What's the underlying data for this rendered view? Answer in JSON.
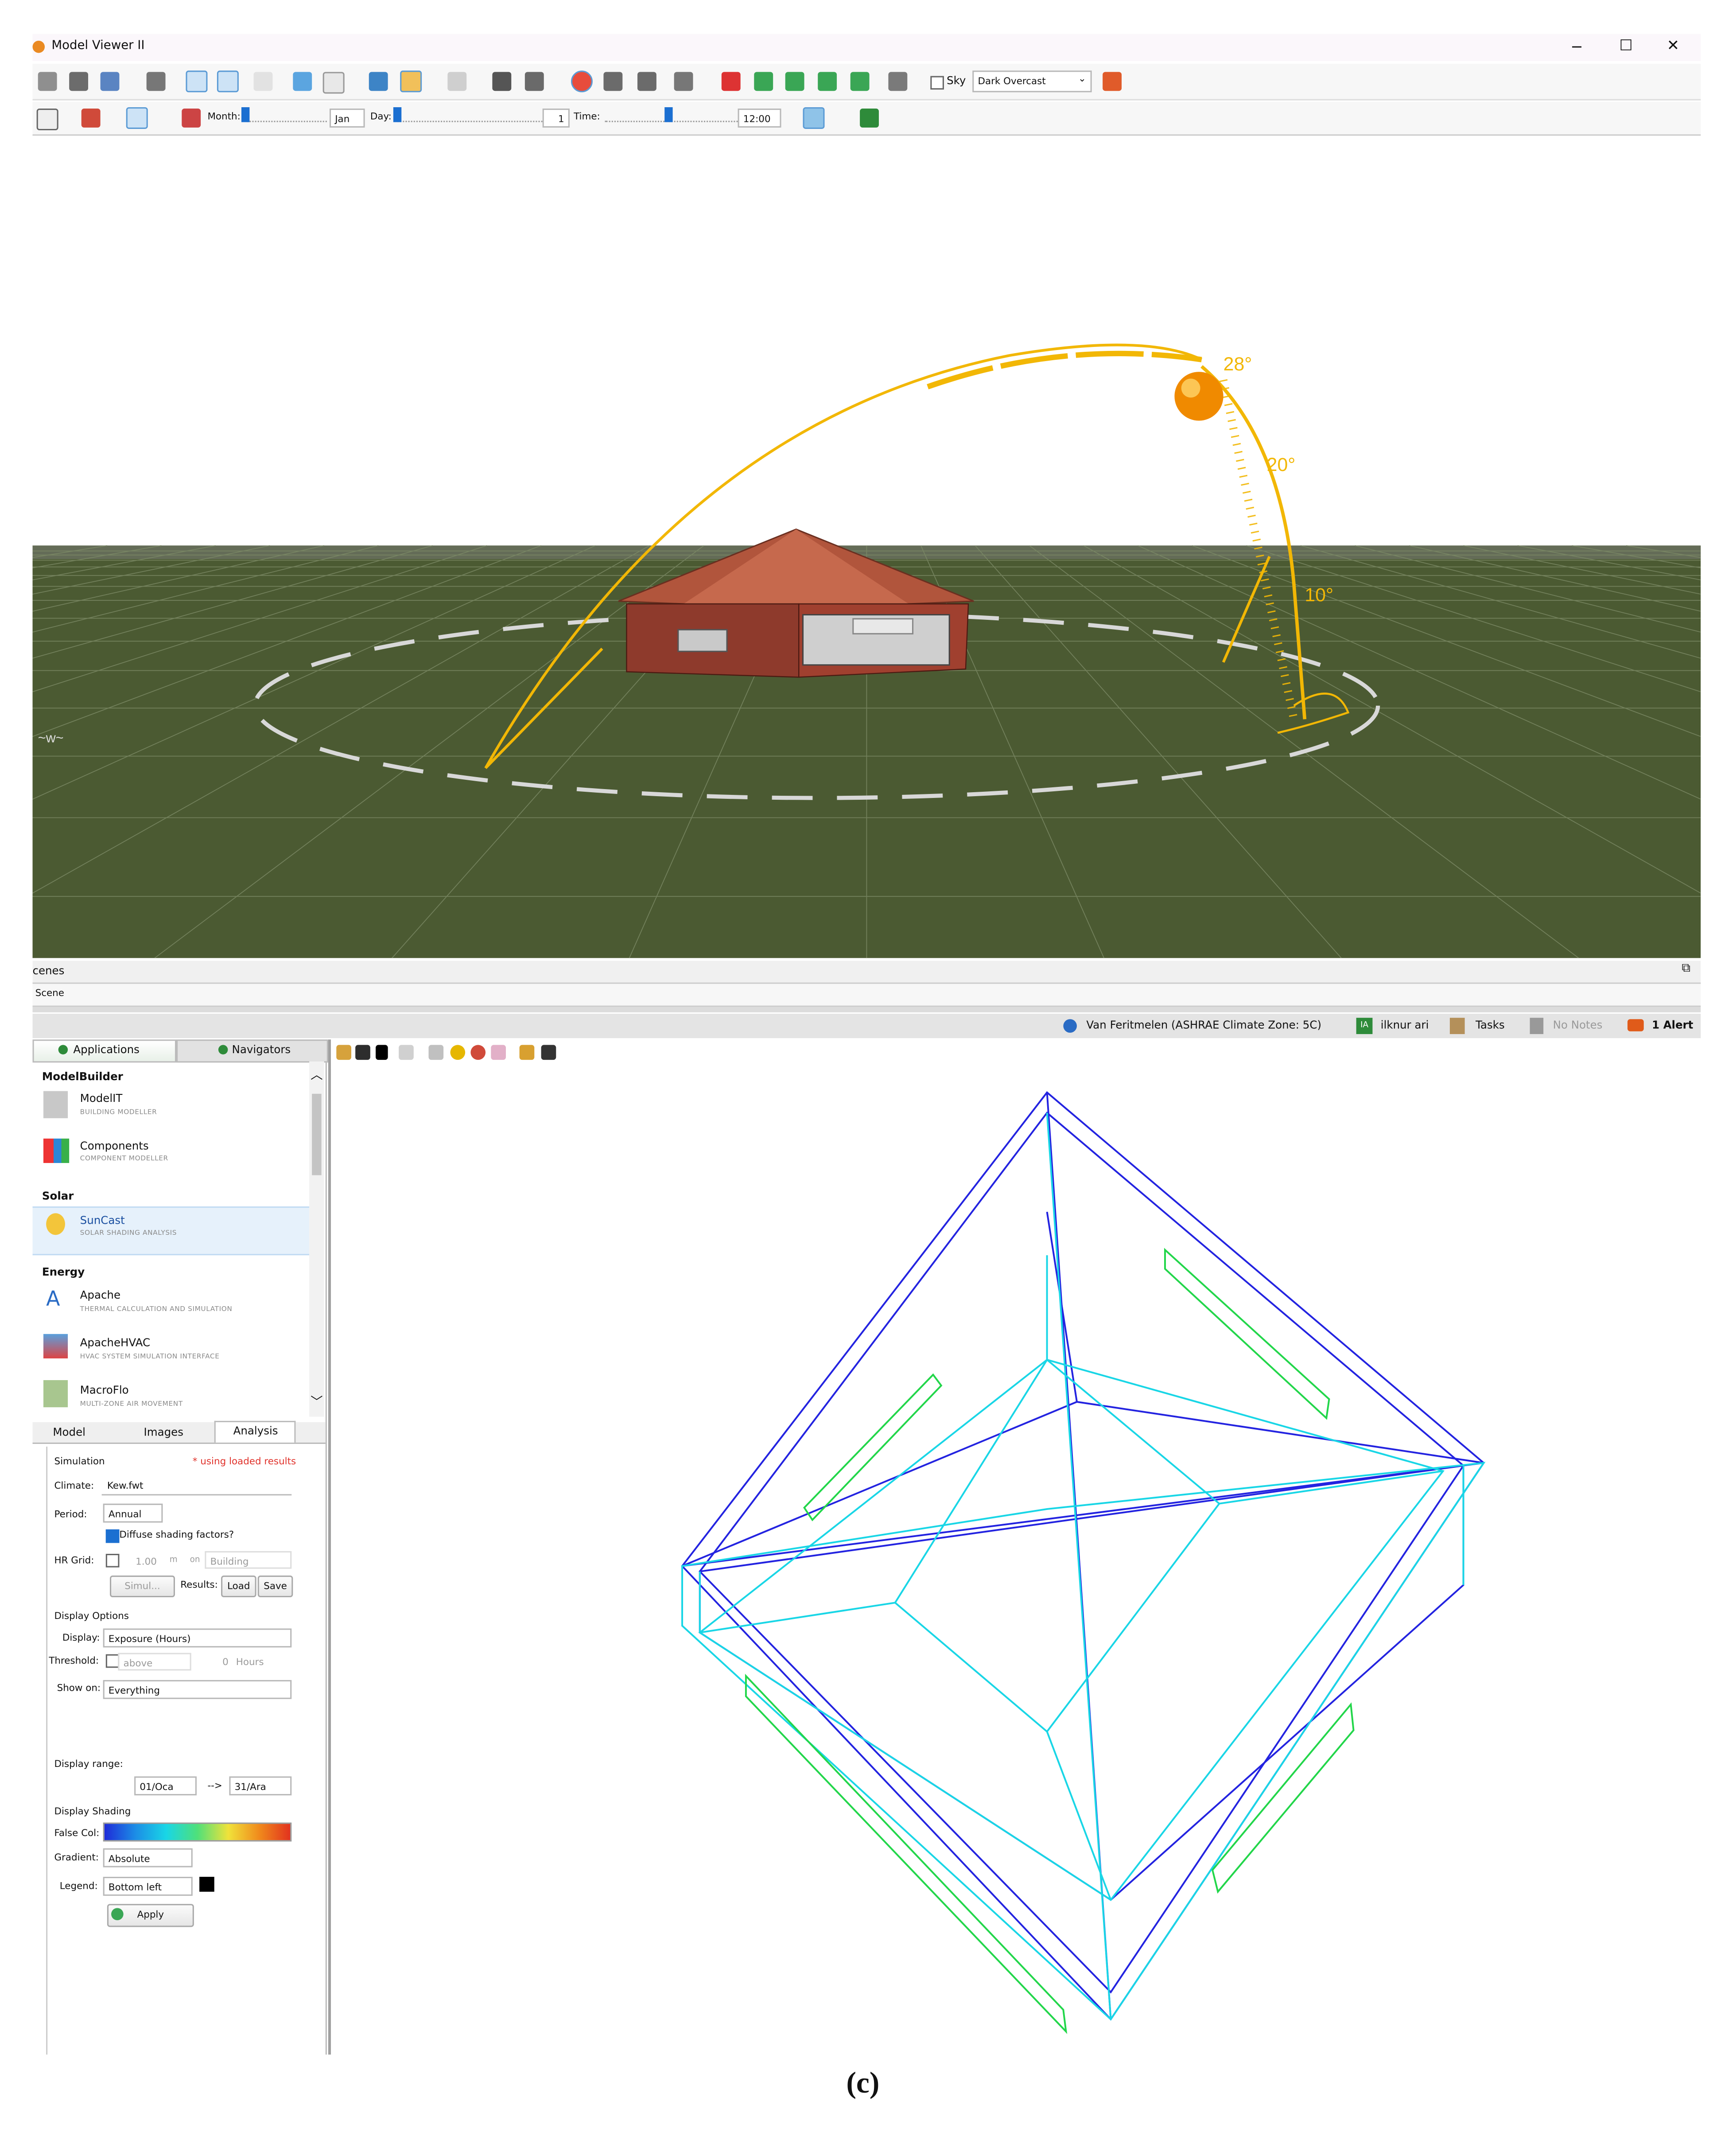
{
  "viewer": {
    "title": "Model Viewer II",
    "window_controls": {
      "minimize": "−",
      "maximize": "☐",
      "close": "✕"
    },
    "sky_label": "Sky",
    "sky_value": "Dark Overcast",
    "month_label": "Month:",
    "month_value": "Jan",
    "day_label": "Day:",
    "day_value": "1",
    "time_label": "Time:",
    "time_value": "12:00",
    "angles": [
      "28°",
      "20°",
      "10°"
    ]
  },
  "scenes": {
    "title": "cenes",
    "item": "Scene"
  },
  "status": {
    "location": "Van Feritmelen (ASHRAE Climate Zone: 5C)",
    "user_initials": "IA",
    "user": "ilknur ari",
    "tasks": "Tasks",
    "notes": "No Notes",
    "alert": "1 Alert"
  },
  "nav_tabs": [
    "Applications",
    "Navigators"
  ],
  "applications": {
    "sections": [
      {
        "title": "ModelBuilder",
        "items": [
          {
            "name": "ModelIT",
            "sub": "BUILDING MODELLER"
          },
          {
            "name": "Components",
            "sub": "COMPONENT MODELLER"
          }
        ]
      },
      {
        "title": "Solar",
        "items": [
          {
            "name": "SunCast",
            "sub": "SOLAR SHADING ANALYSIS"
          }
        ]
      },
      {
        "title": "Energy",
        "items": [
          {
            "name": "Apache",
            "sub": "THERMAL CALCULATION AND SIMULATION"
          },
          {
            "name": "ApacheHVAC",
            "sub": "HVAC SYSTEM SIMULATION INTERFACE"
          },
          {
            "name": "MacroFlo",
            "sub": "MULTI-ZONE AIR MOVEMENT"
          }
        ]
      }
    ]
  },
  "lower_tabs": [
    "Model",
    "Images",
    "Analysis"
  ],
  "analysis": {
    "simulation_label": "Simulation",
    "loaded_note": "* using loaded results",
    "climate_label": "Climate:",
    "climate_value": "Kew.fwt",
    "period_label": "Period:",
    "period_value": "Annual",
    "diffuse_label": "Diffuse shading factors?",
    "hr_grid_label": "HR Grid:",
    "hr_grid_value": "1.00",
    "hr_grid_unit": "m",
    "hr_grid_on": "on",
    "hr_grid_target": "Building",
    "simulate_button": "Simul...",
    "results_label": "Results:",
    "load_button": "Load",
    "save_button": "Save",
    "display_options_label": "Display Options",
    "display_label": "Display:",
    "display_value": "Exposure (Hours)",
    "threshold_label": "Threshold:",
    "threshold_mode": "above",
    "threshold_value": "0",
    "threshold_unit": "Hours",
    "show_on_label": "Show on:",
    "show_on_value": "Everything",
    "display_range_label": "Display range:",
    "range_start": "01/Oca",
    "range_arrow": "-->",
    "range_end": "31/Ara",
    "display_shading_label": "Display Shading",
    "false_col_label": "False Col:",
    "gradient_label": "Gradient:",
    "gradient_value": "Absolute",
    "legend_label": "Legend:",
    "legend_value": "Bottom left",
    "apply_button": "Apply"
  },
  "caption": "(c)",
  "colors": {
    "ground": "#4b5a32",
    "sun_path": "#f2b705",
    "wire_blue": "#2323e0",
    "wire_cyan": "#19d6e6",
    "wire_green": "#22d64a",
    "accent": "#1a6fd1"
  }
}
